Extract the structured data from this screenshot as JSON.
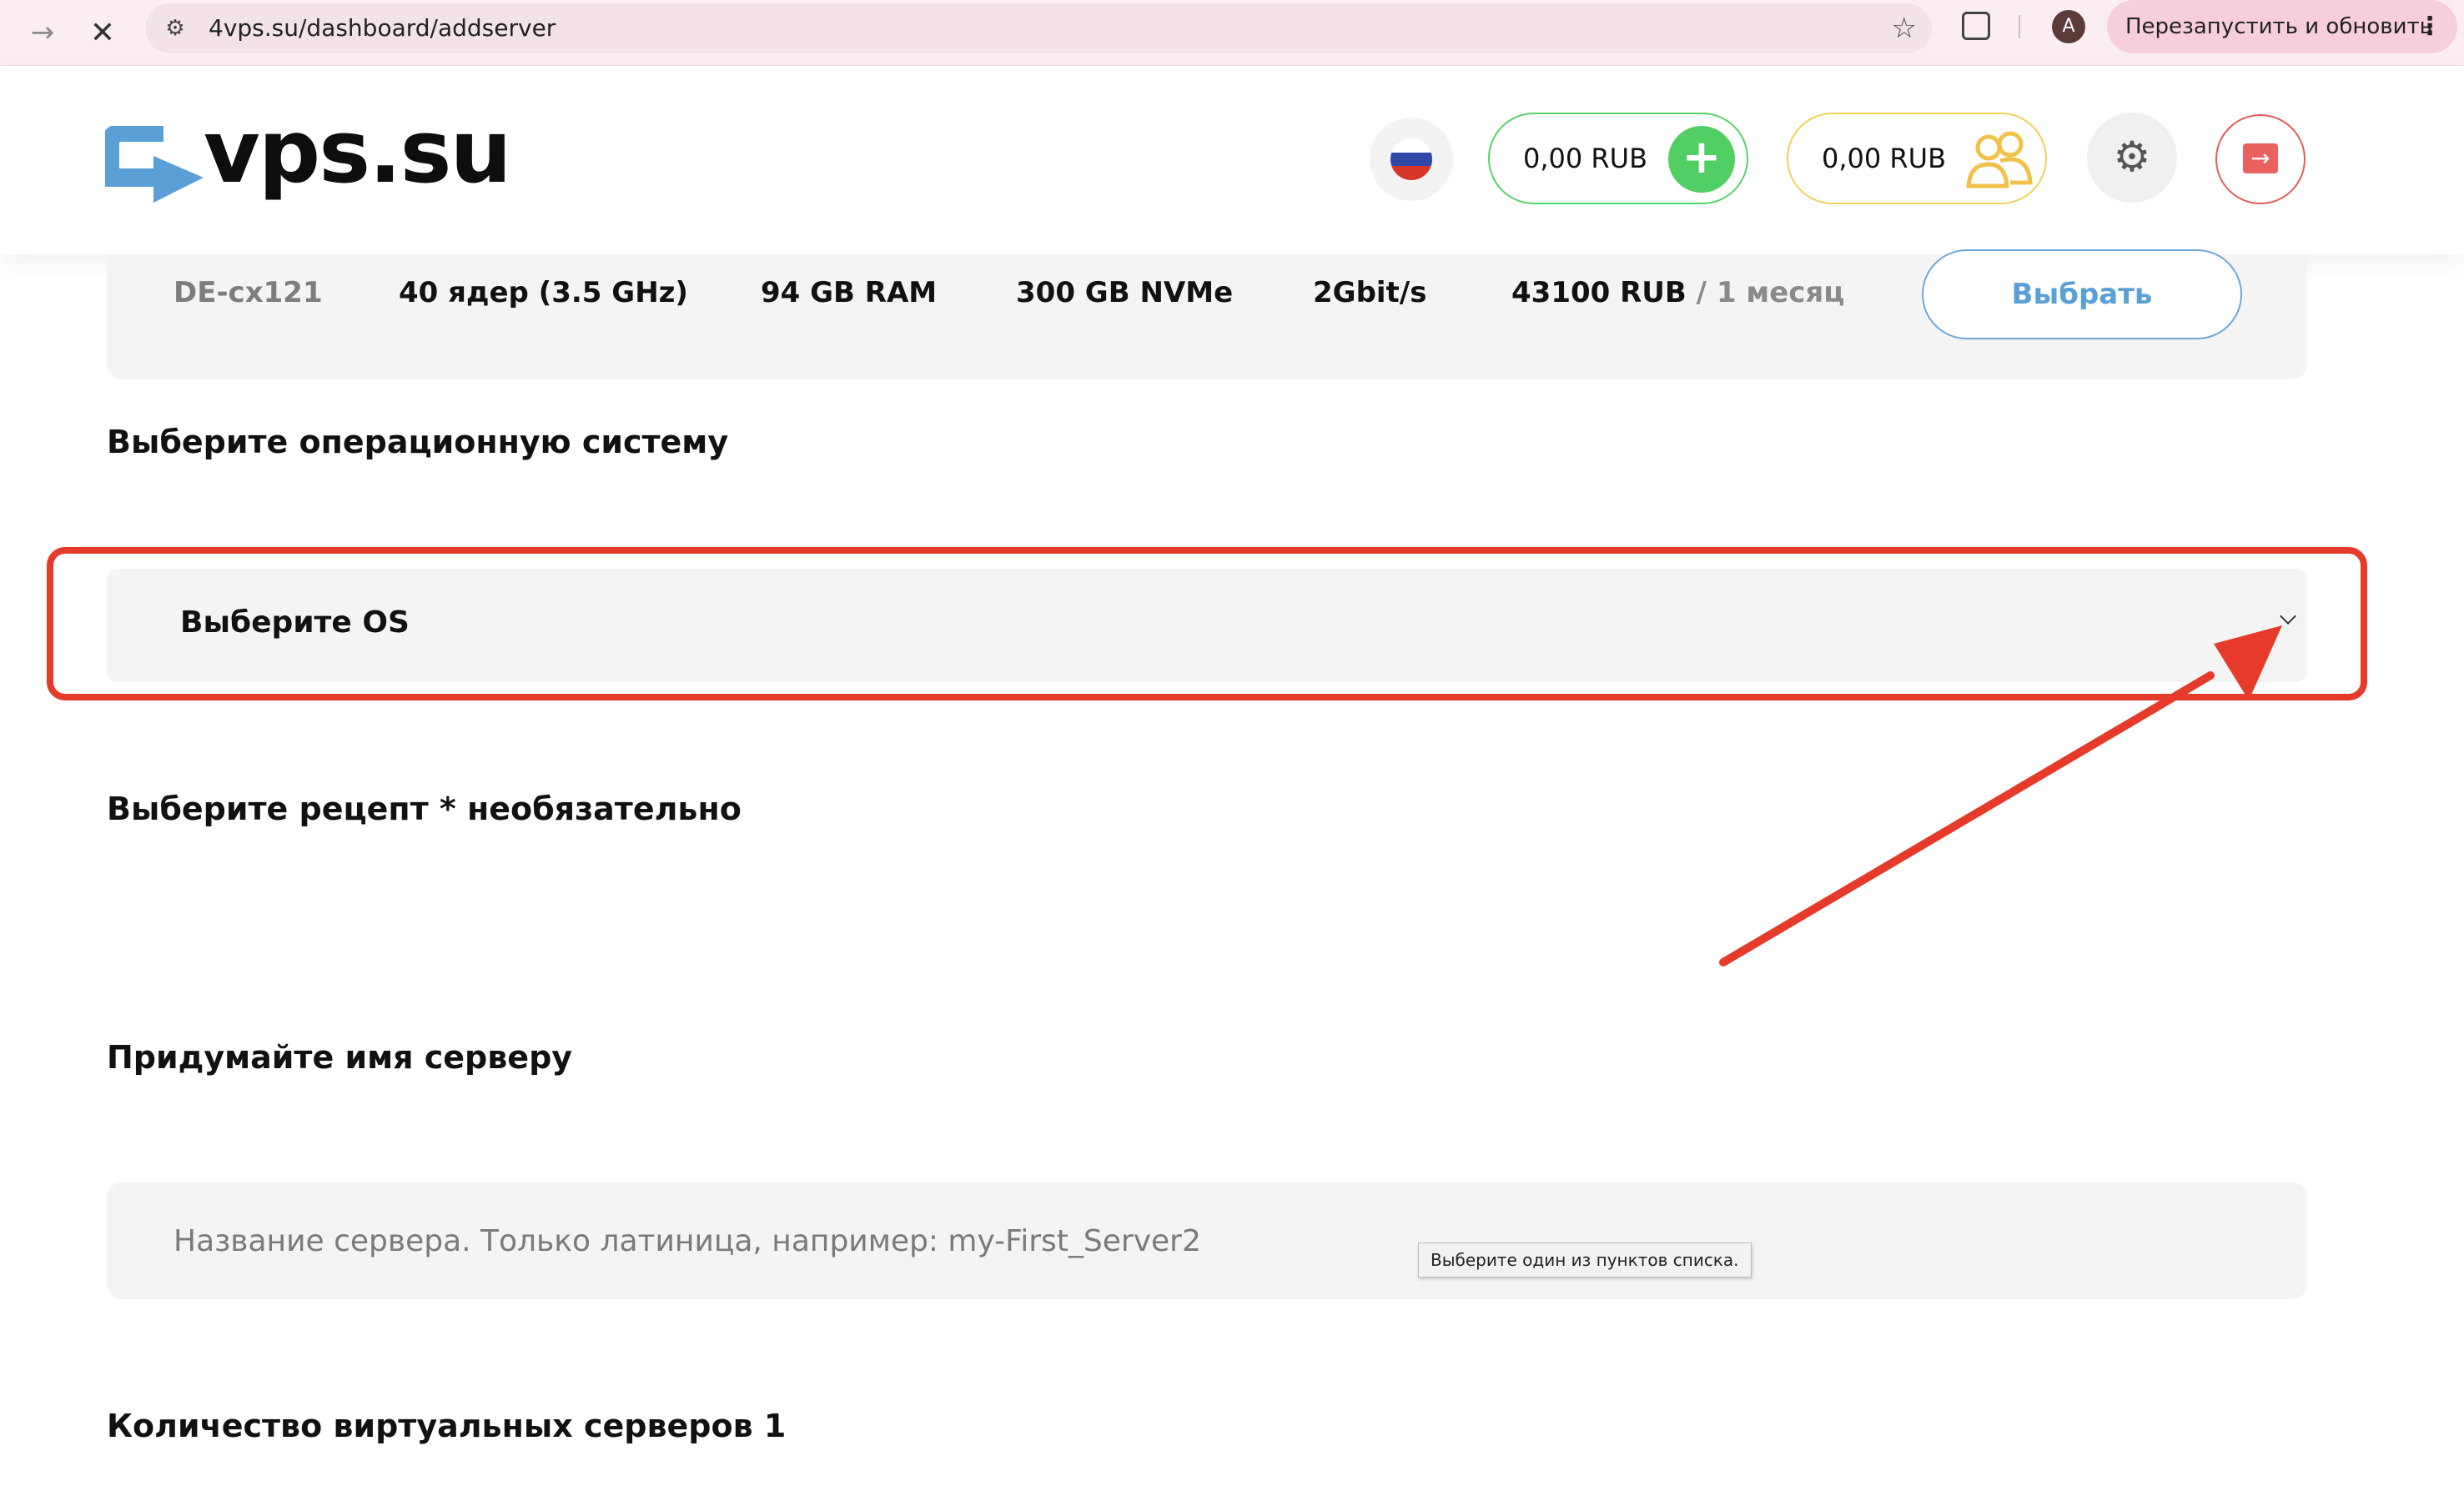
{
  "browser": {
    "url": "4vps.su/dashboard/addserver",
    "profile_initial": "A",
    "relaunch_label": "Перезапустить и обновить",
    "menu_icon": "⋮"
  },
  "header": {
    "logo_text": "vps.su",
    "balance_main": "0,00 RUB",
    "balance_partner": "0,00 RUB",
    "plus_symbol": "+",
    "colors": {
      "green": "#52cf64",
      "yellow": "#f0c24a",
      "blue": "#5aa0d6",
      "red": "#e8615f"
    }
  },
  "tariff": {
    "name": "DE-cx121",
    "cpu": "40 ядер (3.5 GHz)",
    "ram": "94 GB RAM",
    "disk": "300 GB NVMe",
    "network": "2Gbit/s",
    "price": "43100 RUB",
    "period": "/ 1 месяц",
    "select_label": "Выбрать"
  },
  "form": {
    "os_title": "Выберите операционную систему",
    "os_select_value": "Выберите OS",
    "recipe_title": "Выберите рецепт * необязательно",
    "name_title": "Придумайте имя серверу",
    "name_placeholder": "Название сервера. Только латиница, например: my-First_Server2",
    "count_title": "Количество виртуальных серверов",
    "count_value": "1"
  },
  "tooltip": {
    "text": "Выберите один из пунктов списка."
  },
  "annotation": {
    "color": "#e63b2a"
  }
}
